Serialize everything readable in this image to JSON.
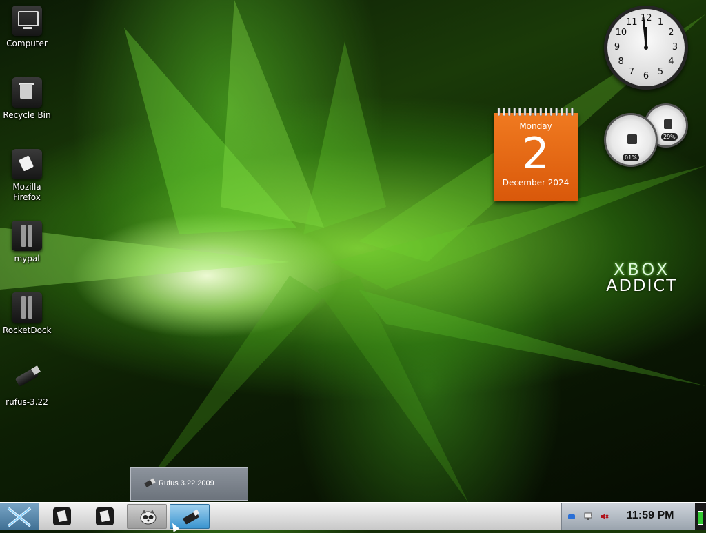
{
  "desktop": {
    "icons": [
      {
        "label": "Computer",
        "icon": "computer-icon"
      },
      {
        "label": "Recycle Bin",
        "icon": "recycle-bin-icon"
      },
      {
        "label": "Mozilla Firefox",
        "icon": "firefox-icon"
      },
      {
        "label": "mypal",
        "icon": "mypal-icon"
      },
      {
        "label": "RocketDock",
        "icon": "rocketdock-icon"
      },
      {
        "label": "rufus-3.22",
        "icon": "usb-drive-icon"
      }
    ]
  },
  "widgets": {
    "clock": {
      "numbers": [
        "12",
        "1",
        "2",
        "3",
        "4",
        "5",
        "6",
        "7",
        "8",
        "9",
        "10",
        "11"
      ],
      "hour": 11,
      "minute": 59
    },
    "calendar": {
      "weekday": "Monday",
      "day": "2",
      "month_year": "December 2024"
    },
    "meters": {
      "cpu_percent": "01%",
      "memory_percent": "29%"
    }
  },
  "branding": {
    "line1": "XBOX",
    "line2": "ADDICT"
  },
  "tooltip": {
    "text": "Rufus 3.22.2009"
  },
  "taskbar": {
    "start_icon": "start-orb-icon",
    "buttons": [
      {
        "name": "notepad-1",
        "icon": "notepad-icon"
      },
      {
        "name": "notepad-2",
        "icon": "notepad-icon"
      },
      {
        "name": "raccoon-app",
        "icon": "raccoon-icon"
      },
      {
        "name": "rufus",
        "icon": "usb-drive-icon"
      }
    ],
    "tray": {
      "time": "11:59 PM",
      "icons": [
        "network-icon",
        "display-icon",
        "volume-muted-icon"
      ]
    }
  },
  "colors": {
    "calendar": "#e8650f",
    "accent_green": "#6bd12a",
    "taskbar_hover": "#3a94cf"
  }
}
